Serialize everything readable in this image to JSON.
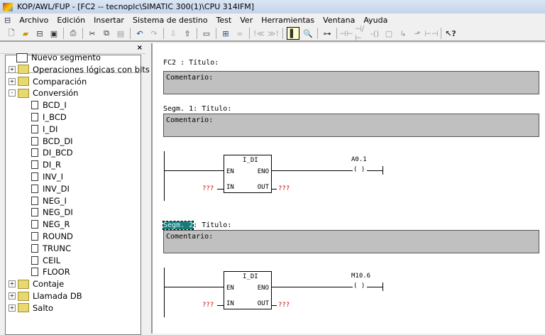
{
  "window": {
    "title": "KOP/AWL/FUP  - [FC2 -- tecnoplc\\SIMATIC 300(1)\\CPU 314IFM]"
  },
  "menu": [
    "Archivo",
    "Edición",
    "Insertar",
    "Sistema de destino",
    "Test",
    "Ver",
    "Herramientas",
    "Ventana",
    "Ayuda"
  ],
  "toolbar": {
    "icons": [
      "new",
      "open",
      "accessible-nodes",
      "save",
      "print",
      "cut",
      "copy",
      "paste",
      "undo",
      "redo",
      "download",
      "upload",
      "overview",
      "network",
      "monitor",
      "skip-back",
      "skip-fwd",
      "program-elements",
      "details",
      "insert-network",
      "no-contact",
      "nc-contact",
      "coil",
      "box",
      "branch-open",
      "branch-close",
      "jump",
      "help"
    ]
  },
  "tree": {
    "items": [
      {
        "label": "Nuevo segmento",
        "type": "segment"
      },
      {
        "label": "Operaciones lógicas con bits",
        "type": "folder",
        "state": "+"
      },
      {
        "label": "Comparación",
        "type": "folder",
        "state": "+"
      },
      {
        "label": "Conversión",
        "type": "folder",
        "state": "-"
      },
      {
        "label": "BCD_I",
        "type": "block"
      },
      {
        "label": "I_BCD",
        "type": "block"
      },
      {
        "label": "I_DI",
        "type": "block"
      },
      {
        "label": "BCD_DI",
        "type": "block"
      },
      {
        "label": "DI_BCD",
        "type": "block"
      },
      {
        "label": "DI_R",
        "type": "block"
      },
      {
        "label": "INV_I",
        "type": "block"
      },
      {
        "label": "INV_DI",
        "type": "block"
      },
      {
        "label": "NEG_I",
        "type": "block"
      },
      {
        "label": "NEG_DI",
        "type": "block"
      },
      {
        "label": "NEG_R",
        "type": "block"
      },
      {
        "label": "ROUND",
        "type": "block"
      },
      {
        "label": "TRUNC",
        "type": "block"
      },
      {
        "label": "CEIL",
        "type": "block"
      },
      {
        "label": "FLOOR",
        "type": "block"
      },
      {
        "label": "Contaje",
        "type": "folder",
        "state": "+"
      },
      {
        "label": "Llamada DB",
        "type": "folder",
        "state": "+"
      },
      {
        "label": "Salto",
        "type": "folder",
        "state": "+"
      }
    ]
  },
  "editor": {
    "block_title": "FC2 : Título:",
    "block_comment": "Comentario:",
    "networks": [
      {
        "label": "Segm. 1",
        "title": ": Título:",
        "comment": "Comentario:",
        "box": "I_DI",
        "en": "EN",
        "eno": "ENO",
        "in": "IN",
        "out": "OUT",
        "in_val": "???",
        "out_val": "???",
        "coil": "A0.1",
        "coil_sym": "( )"
      },
      {
        "label": "Segm. 2",
        "title": ": Título:",
        "comment": "Comentario:",
        "box": "I_DI",
        "en": "EN",
        "eno": "ENO",
        "in": "IN",
        "out": "OUT",
        "in_val": "???",
        "out_val": "???",
        "coil": "M10.6",
        "coil_sym": "( )"
      }
    ]
  }
}
